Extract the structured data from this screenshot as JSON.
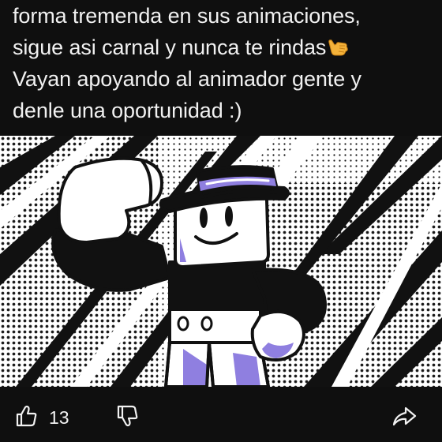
{
  "comment": {
    "lines": [
      "forma tremenda en sus animaciones,",
      "sigue asi carnal y nunca te rindas",
      "Vayan apoyando al animador gente y",
      "denle una oportunidad :)"
    ],
    "emoji": "call-me-hand-emoji"
  },
  "image": {
    "icon": "animated-character-illustration"
  },
  "actions": {
    "like_count": "13",
    "like_icon": "thumbs-up-icon",
    "dislike_icon": "thumbs-down-icon",
    "share_icon": "share-icon"
  },
  "colors": {
    "background": "#0f0f0f",
    "text": "#f1f1f1",
    "character_accent": "#8f7fe0"
  }
}
